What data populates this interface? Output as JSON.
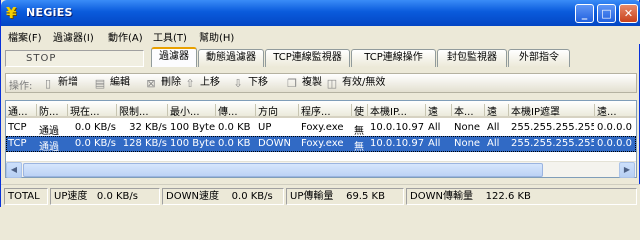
{
  "window": {
    "title": "NEGiES",
    "app_icon": "negies-logo-icon",
    "controls": {
      "minimize": "_",
      "maximize": "□",
      "close": "✕"
    }
  },
  "menubar": [
    "檔案(F)",
    "過濾器(I)",
    "動作(A)",
    "工具(T)",
    "幫助(H)"
  ],
  "stop_status": "STOP",
  "tabs": [
    {
      "label": "過濾器",
      "active": true
    },
    {
      "label": "動態過濾器",
      "active": false
    },
    {
      "label": "TCP連線監視器",
      "active": false
    },
    {
      "label": "TCP連線操作",
      "active": false
    },
    {
      "label": "封包監視器",
      "active": false
    },
    {
      "label": "外部指令",
      "active": false
    }
  ],
  "toolbar": {
    "label": "操作:",
    "buttons": [
      {
        "label": "新增",
        "icon": "new-doc-icon"
      },
      {
        "label": "編輯",
        "icon": "edit-doc-icon"
      },
      {
        "label": "刪除",
        "icon": "delete-icon"
      },
      {
        "label": "上移",
        "icon": "arrow-up-icon"
      },
      {
        "label": "下移",
        "icon": "arrow-down-icon"
      },
      {
        "label": "複製",
        "icon": "copy-icon"
      },
      {
        "label": "有效/無效",
        "icon": "toggle-icon"
      }
    ]
  },
  "table": {
    "columns": [
      "通...",
      "防...",
      "現在...",
      "限制...",
      "最小...",
      "傳...",
      "方向",
      "程序...",
      "使",
      "本機IP...",
      "遠",
      "本...",
      "遠",
      "本機IP遮罩",
      "遠..."
    ],
    "rows": [
      [
        "TCP",
        "通過",
        "0.0 KB/s",
        "32 KB/s",
        "100 Byte",
        "0.0 KB",
        "UP",
        "Foxy.exe",
        "無",
        "10.0.10.97",
        "All",
        "None",
        "All",
        "255.255.255.255",
        "0.0.0.0"
      ],
      [
        "TCP",
        "通過",
        "0.0 KB/s",
        "128 KB/s",
        "100 Byte",
        "0.0 KB",
        "DOWN",
        "Foxy.exe",
        "無",
        "10.0.10.97",
        "All",
        "None",
        "All",
        "255.255.255.255",
        "0.0.0.0"
      ]
    ],
    "selected_row": 1
  },
  "statusbar": {
    "total": "TOTAL",
    "up_speed_label": "UP速度",
    "up_speed": "0.0 KB/s",
    "down_speed_label": "DOWN速度",
    "down_speed": "0.0 KB/s",
    "up_total_label": "UP傳輸量",
    "up_total": "69.5 KB",
    "down_total_label": "DOWN傳輸量",
    "down_total": "122.6 KB"
  },
  "colors": {
    "titlebar": "#0a5bdc",
    "selection": "#316ac5",
    "active_tab_accent": "#e8a000"
  }
}
